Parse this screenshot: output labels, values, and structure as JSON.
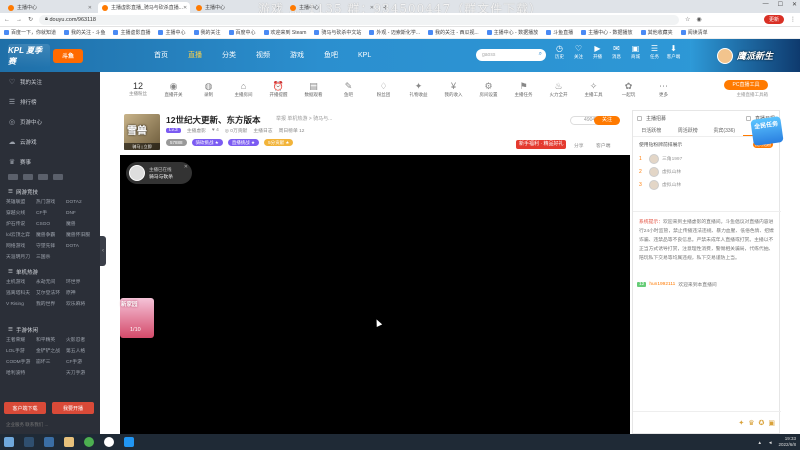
{
  "browser": {
    "tabs": [
      {
        "title": "主播中心",
        "active": false
      },
      {
        "title": "主播虚影直播_骑马与砍杀直播...",
        "active": true
      },
      {
        "title": "主播中心",
        "active": false
      },
      {
        "title": "主播中心",
        "active": false
      }
    ],
    "watermark": "游戏 ... 1135 群：934500447（群文件下载）",
    "url": "douyu.com/963118",
    "update_label": "更新",
    "bookmarks": [
      "百度一下，你就知道",
      "我的关注 - 斗鱼",
      "主播虚影直播",
      "主播中心",
      "我的关注",
      "百度中心",
      "欢迎来到 Steam",
      "骑马与砍杀中文站",
      "外观 - 迈索斯化学...",
      "我的关注 - 西瓜视...",
      "主播中心 - 数据播放",
      "斗鱼直播",
      "主播中心 - 数据播放",
      "其他收藏夹",
      "阅读清单"
    ]
  },
  "site_nav": {
    "logo_kpl": "KPL 夏季赛",
    "logo_brand": "斗鱼",
    "links": [
      {
        "label": "首页",
        "active": false
      },
      {
        "label": "直播",
        "active": true
      },
      {
        "label": "分类",
        "active": false
      },
      {
        "label": "视频",
        "active": false
      },
      {
        "label": "游戏",
        "active": false
      },
      {
        "label": "鱼吧",
        "active": false
      },
      {
        "label": "KPL",
        "active": false
      }
    ],
    "search_placeholder": "gaoss",
    "icons": [
      {
        "name": "history-icon",
        "glyph": "◷",
        "label": "历史"
      },
      {
        "name": "follow-icon",
        "glyph": "♡",
        "label": "关注"
      },
      {
        "name": "broadcast-icon",
        "glyph": "▶",
        "label": "开播"
      },
      {
        "name": "message-icon",
        "glyph": "✉",
        "label": "消息"
      },
      {
        "name": "mall-icon",
        "glyph": "▣",
        "label": "商城"
      },
      {
        "name": "task-icon",
        "glyph": "☰",
        "label": "任务"
      },
      {
        "name": "download-icon",
        "glyph": "⬇",
        "label": "客户端"
      }
    ],
    "banner_text": "鹰派新生"
  },
  "sidebar": {
    "top_items": [
      {
        "icon": "♡",
        "label": "我的关注"
      },
      {
        "icon": "☰",
        "label": "排行榜"
      },
      {
        "icon": "◎",
        "label": "页游中心"
      },
      {
        "icon": "☁",
        "label": "云游戏"
      },
      {
        "icon": "♛",
        "label": "赛事"
      }
    ],
    "sections": [
      {
        "title": "网游竞技",
        "items": [
          "英雄联盟",
          "热门游戏",
          "DOTA2",
          "穿越火线",
          "CF手",
          "DNF",
          "炉石传说",
          "CSGO",
          "魔兽",
          "lol云顶之弈",
          "魔兽争霸",
          "魔兽怀旧服",
          "网络游戏",
          "守望先锋",
          "DOTA",
          "天涯明月刀",
          "三国杀",
          ""
        ]
      },
      {
        "title": "单机热游",
        "items": [
          "主机游戏",
          "永劫无间",
          "环世界",
          "逃离塔科夫",
          "艾尔登法环",
          "原神",
          "V Rising",
          "我的世界",
          "欢乐麻将",
          ""
        ]
      },
      {
        "title": "手游休闲",
        "items": [
          "王者荣耀",
          "和平精英",
          "火影忍者",
          "LOL手游",
          "金铲铲之战",
          "第五人格",
          "CODM手游",
          "崩坏三",
          "CF手游",
          "哈利波特",
          "",
          "天刀手游"
        ]
      }
    ],
    "buttons": [
      "客户端下载",
      "我要开播"
    ],
    "footer": "企业服务  联系我们  ..."
  },
  "category_strip": {
    "followers_count": "12",
    "followers_label": "主播粉丝",
    "items": [
      {
        "name": "live-icon",
        "glyph": "◉",
        "label": "直播开关"
      },
      {
        "name": "record-icon",
        "glyph": "◍",
        "label": "录制"
      },
      {
        "name": "room-icon",
        "glyph": "⌂",
        "label": "主播房间"
      },
      {
        "name": "stream-icon",
        "glyph": "⏰",
        "label": "开播提醒"
      },
      {
        "name": "data-icon",
        "glyph": "▤",
        "label": "数据观看"
      },
      {
        "name": "fishbar-icon",
        "glyph": "✎",
        "label": "鱼吧"
      },
      {
        "name": "fans-icon",
        "glyph": "♢",
        "label": "粉丝团"
      },
      {
        "name": "gift-icon",
        "glyph": "✦",
        "label": "礼物收益"
      },
      {
        "name": "income-icon",
        "glyph": "¥",
        "label": "我的收入"
      },
      {
        "name": "settings-icon",
        "glyph": "⚙",
        "label": "房间设置"
      },
      {
        "name": "mission-icon",
        "glyph": "⚑",
        "label": "主播任务"
      },
      {
        "name": "fire-icon",
        "glyph": "♨",
        "label": "火力全开"
      },
      {
        "name": "tool-icon",
        "glyph": "✧",
        "label": "主播工具"
      },
      {
        "name": "help-icon",
        "glyph": "✿",
        "label": "一起玩"
      },
      {
        "name": "more-icon",
        "glyph": "⋯",
        "label": "更多"
      }
    ],
    "pc_button": "PC直播工具",
    "pc_sub": "主播直播工具箱"
  },
  "stream": {
    "cover_title": "雪兽",
    "cover_label": "骑马 | 立即",
    "title": "12世纪大更新、东方版本",
    "tag": "举报  单机热游 > 骑马与...",
    "level": "Lv.3",
    "meta": [
      "主播虚影",
      "♥ 4",
      "◎ 0万贡献",
      "主播日志",
      "周日榜单 12"
    ],
    "badges": [
      {
        "label": "57888",
        "color": "#999999"
      },
      {
        "label": "骑砍挑战 ★",
        "color": "#7b5bf2"
      },
      {
        "label": "直播挑战 ★",
        "color": "#7b5bf2"
      },
      {
        "label": "5分贡献 ★",
        "color": "#f2b43a"
      }
    ],
    "hot_value": "49041",
    "follow_label": "关注",
    "promo": "新手福利 · 精品好礼",
    "share": "分享",
    "report": "客户端"
  },
  "player": {
    "anchor_sub": "主播已在线",
    "anchor_name": "骑马与砍杀",
    "gift_title": "新家园",
    "gift_count": "1/10"
  },
  "right_panel": {
    "title": "主播招募",
    "quick_label": "直播日报",
    "tabs": [
      {
        "label": "日活跃榜",
        "active": false
      },
      {
        "label": "周活跃榜",
        "active": false
      },
      {
        "label": "贵宾(336)",
        "active": false
      },
      {
        "label": "粉丝",
        "active": true
      }
    ],
    "hint": "使用钻粉牌前排展示",
    "open_btn": "成为钻粉",
    "users": [
      {
        "rank": "1",
        "name": "三角1997"
      },
      {
        "rank": "2",
        "name": "虚拟山林"
      },
      {
        "rank": "3",
        "name": "虚拟山林"
      }
    ],
    "sys_label": "系统提示：",
    "sys_text": "欢迎来到主播虚影的直播间。斗鱼倡议对直播内容进行24小时监管，禁止传播违法违规、暴力血腥、低俗色情、招嫖诈骗、违禁品等不良信息。严禁未成年人直播或打赏。主播以不正当方式诱导打赏，注意理性消费，警惕相关骗局，代练代抽、陪玩私下交易等均属违规，私下交易谨防上当。",
    "welcome_level": "12",
    "welcome_name": "hun1992111",
    "welcome_text": "欢迎来到本直播间",
    "badge": "全民任务"
  },
  "taskbar": {
    "clock_time": "19:33",
    "clock_date": "2022/6/8"
  }
}
